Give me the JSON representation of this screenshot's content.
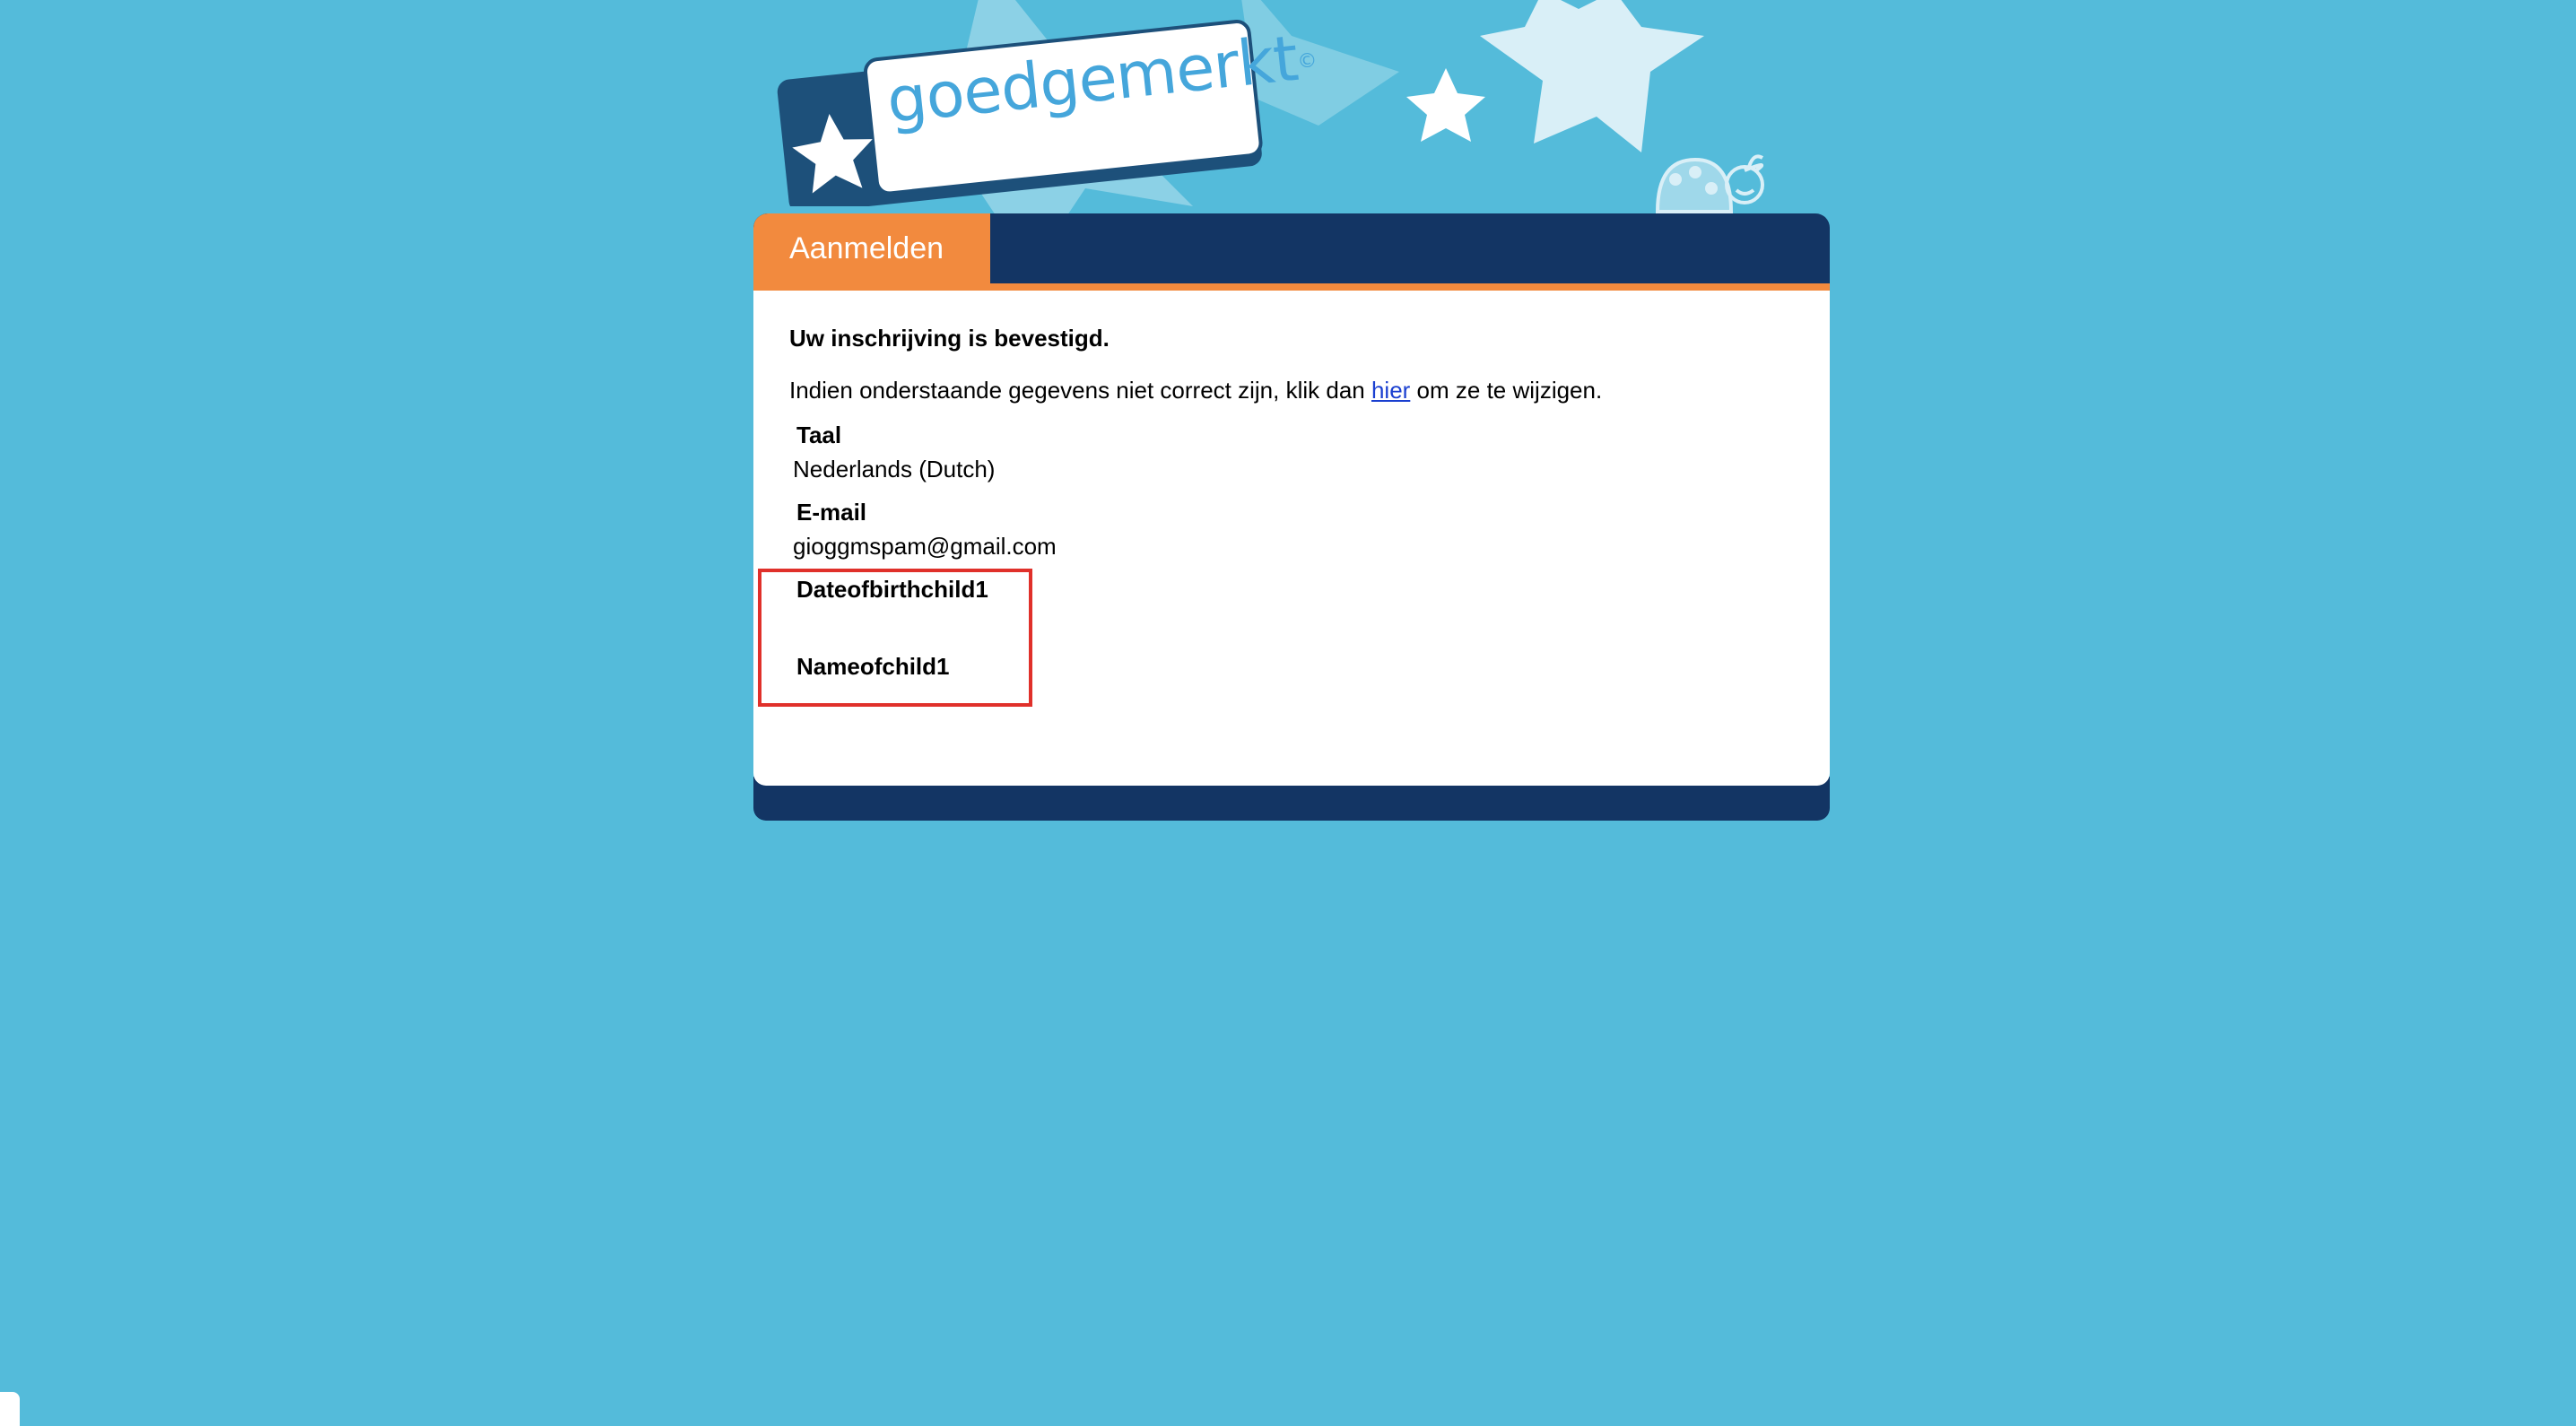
{
  "logo": {
    "text": "goedgemerkt",
    "mark": "©"
  },
  "tab": {
    "label": "Aanmelden"
  },
  "content": {
    "confirmation": "Uw inschrijving is bevestigd.",
    "info_prefix": "Indien onderstaande gegevens niet correct zijn, klik dan ",
    "info_link": "hier",
    "info_suffix": " om ze te wijzigen."
  },
  "fields": [
    {
      "label": "Taal",
      "value": "Nederlands (Dutch)"
    },
    {
      "label": "E-mail",
      "value": "gioggmspam@gmail.com"
    },
    {
      "label": "Dateofbirthchild1",
      "value": ""
    },
    {
      "label": "Nameofchild1",
      "value": ""
    }
  ],
  "colors": {
    "background": "#54bbda",
    "header": "#133564",
    "accent": "#f28a3e",
    "link": "#1a3fd0",
    "highlight": "#e0302a"
  },
  "icons": [
    "star-icon",
    "ladybug-icon"
  ]
}
